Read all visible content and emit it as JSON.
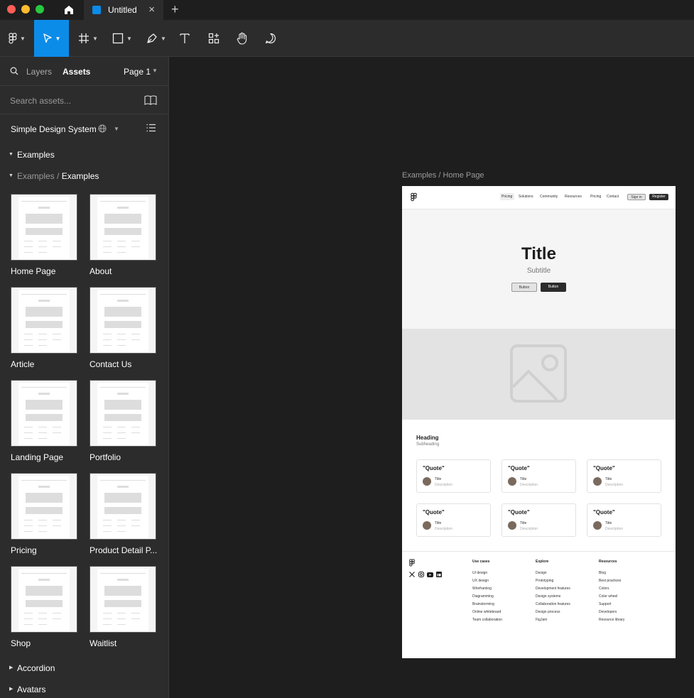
{
  "titlebar": {
    "tab_title": "Untitled"
  },
  "toolbar": {
    "tools": [
      "main-menu",
      "move",
      "frame",
      "shape",
      "pen",
      "text",
      "actions",
      "hand",
      "comment"
    ]
  },
  "panel": {
    "tab_layers": "Layers",
    "tab_assets": "Assets",
    "page_label": "Page 1",
    "search_placeholder": "Search assets...",
    "library_name": "Simple Design System",
    "section_examples": "Examples",
    "breadcrumb_parent": "Examples",
    "breadcrumb_sep": "/",
    "breadcrumb_current": "Examples",
    "thumbs": [
      {
        "label": "Home Page"
      },
      {
        "label": "About"
      },
      {
        "label": "Article"
      },
      {
        "label": "Contact Us"
      },
      {
        "label": "Landing Page"
      },
      {
        "label": "Portfolio"
      },
      {
        "label": "Pricing"
      },
      {
        "label": "Product Detail P..."
      },
      {
        "label": "Shop"
      },
      {
        "label": "Waitlist"
      }
    ],
    "section_accordion": "Accordion",
    "section_avatars": "Avatars"
  },
  "canvas": {
    "frame_label": "Examples / Home Page",
    "nav": {
      "links": [
        "Pricing",
        "Solutions",
        "Community",
        "Resources",
        "Pricing",
        "Contact"
      ],
      "sign_in": "Sign in",
      "register": "Register"
    },
    "hero": {
      "title": "Title",
      "subtitle": "Subtitle",
      "button1": "Button",
      "button2": "Button"
    },
    "section": {
      "heading": "Heading",
      "subheading": "Subheading"
    },
    "quotes": [
      {
        "quote": "\"Quote\"",
        "title": "Title",
        "desc": "Description"
      },
      {
        "quote": "\"Quote\"",
        "title": "Title",
        "desc": "Description"
      },
      {
        "quote": "\"Quote\"",
        "title": "Title",
        "desc": "Description"
      },
      {
        "quote": "\"Quote\"",
        "title": "Title",
        "desc": "Description"
      },
      {
        "quote": "\"Quote\"",
        "title": "Title",
        "desc": "Description"
      },
      {
        "quote": "\"Quote\"",
        "title": "Title",
        "desc": "Description"
      }
    ],
    "footer": {
      "col1": {
        "head": "Use cases",
        "links": [
          "UI design",
          "UX design",
          "Wireframing",
          "Diagramming",
          "Brainstorming",
          "Online whiteboard",
          "Team collaboration"
        ]
      },
      "col2": {
        "head": "Explore",
        "links": [
          "Design",
          "Prototyping",
          "Development features",
          "Design systems",
          "Collaboration features",
          "Design process",
          "FigJam"
        ]
      },
      "col3": {
        "head": "Resources",
        "links": [
          "Blog",
          "Best practices",
          "Colors",
          "Color wheel",
          "Support",
          "Developers",
          "Resource library"
        ]
      }
    }
  },
  "colors": {
    "accent": "#0c8ce9",
    "panel_bg": "#2c2c2c",
    "canvas_bg": "#1e1e1e"
  }
}
